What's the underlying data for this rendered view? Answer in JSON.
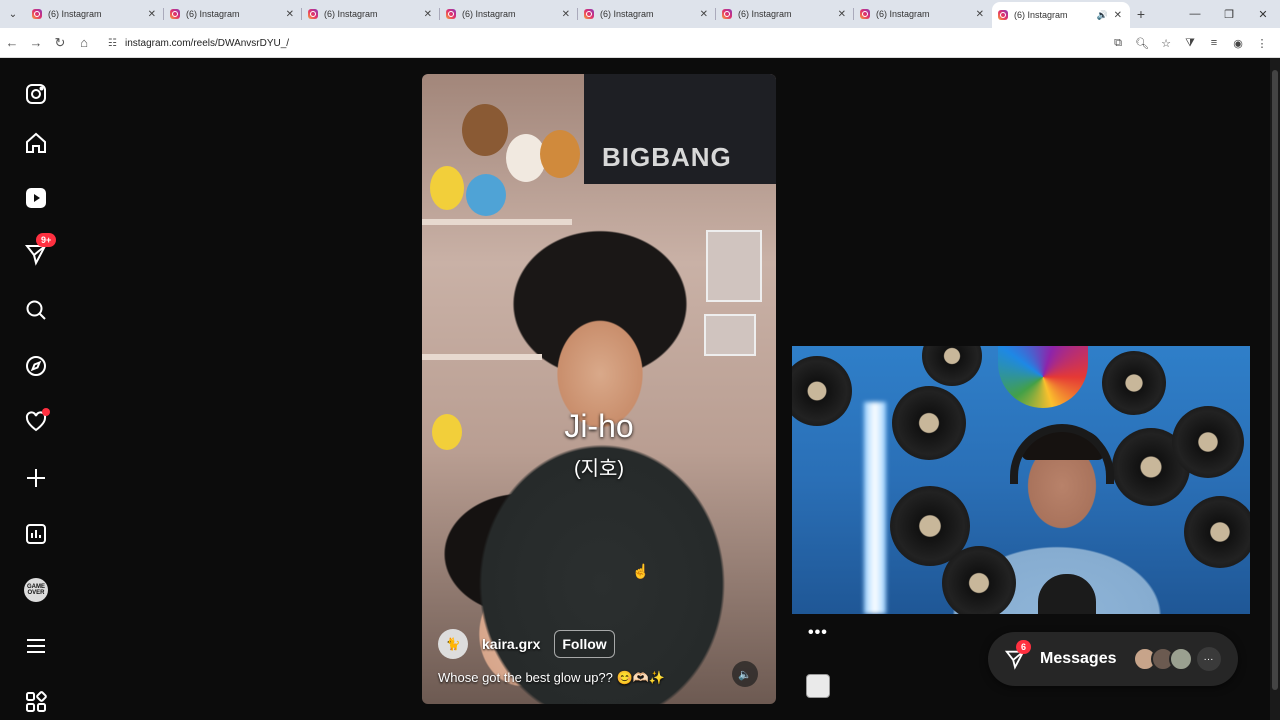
{
  "browser": {
    "tabs": [
      {
        "title": "(6) Instagram"
      },
      {
        "title": "(6) Instagram"
      },
      {
        "title": "(6) Instagram"
      },
      {
        "title": "(6) Instagram"
      },
      {
        "title": "(6) Instagram"
      },
      {
        "title": "(6) Instagram"
      },
      {
        "title": "(6) Instagram"
      },
      {
        "title": "(6) Instagram"
      }
    ],
    "url": "instagram.com/reels/DWAnvsrDYU_/"
  },
  "sidebar": {
    "notifications_badge": "9+"
  },
  "reel": {
    "poster_text": "BIGBANG",
    "caption_name": "Ji-ho",
    "caption_sub": "(지호)",
    "username": "kaira.grx",
    "follow_label": "Follow",
    "caption": "Whose got the best glow up?? 😊🫶🏻✨"
  },
  "messages": {
    "label": "Messages",
    "badge": "6"
  },
  "colors": {
    "badge_red": "#ff3040",
    "page_bg": "#0c0c0c",
    "chrome_bg": "#dee3eb"
  }
}
